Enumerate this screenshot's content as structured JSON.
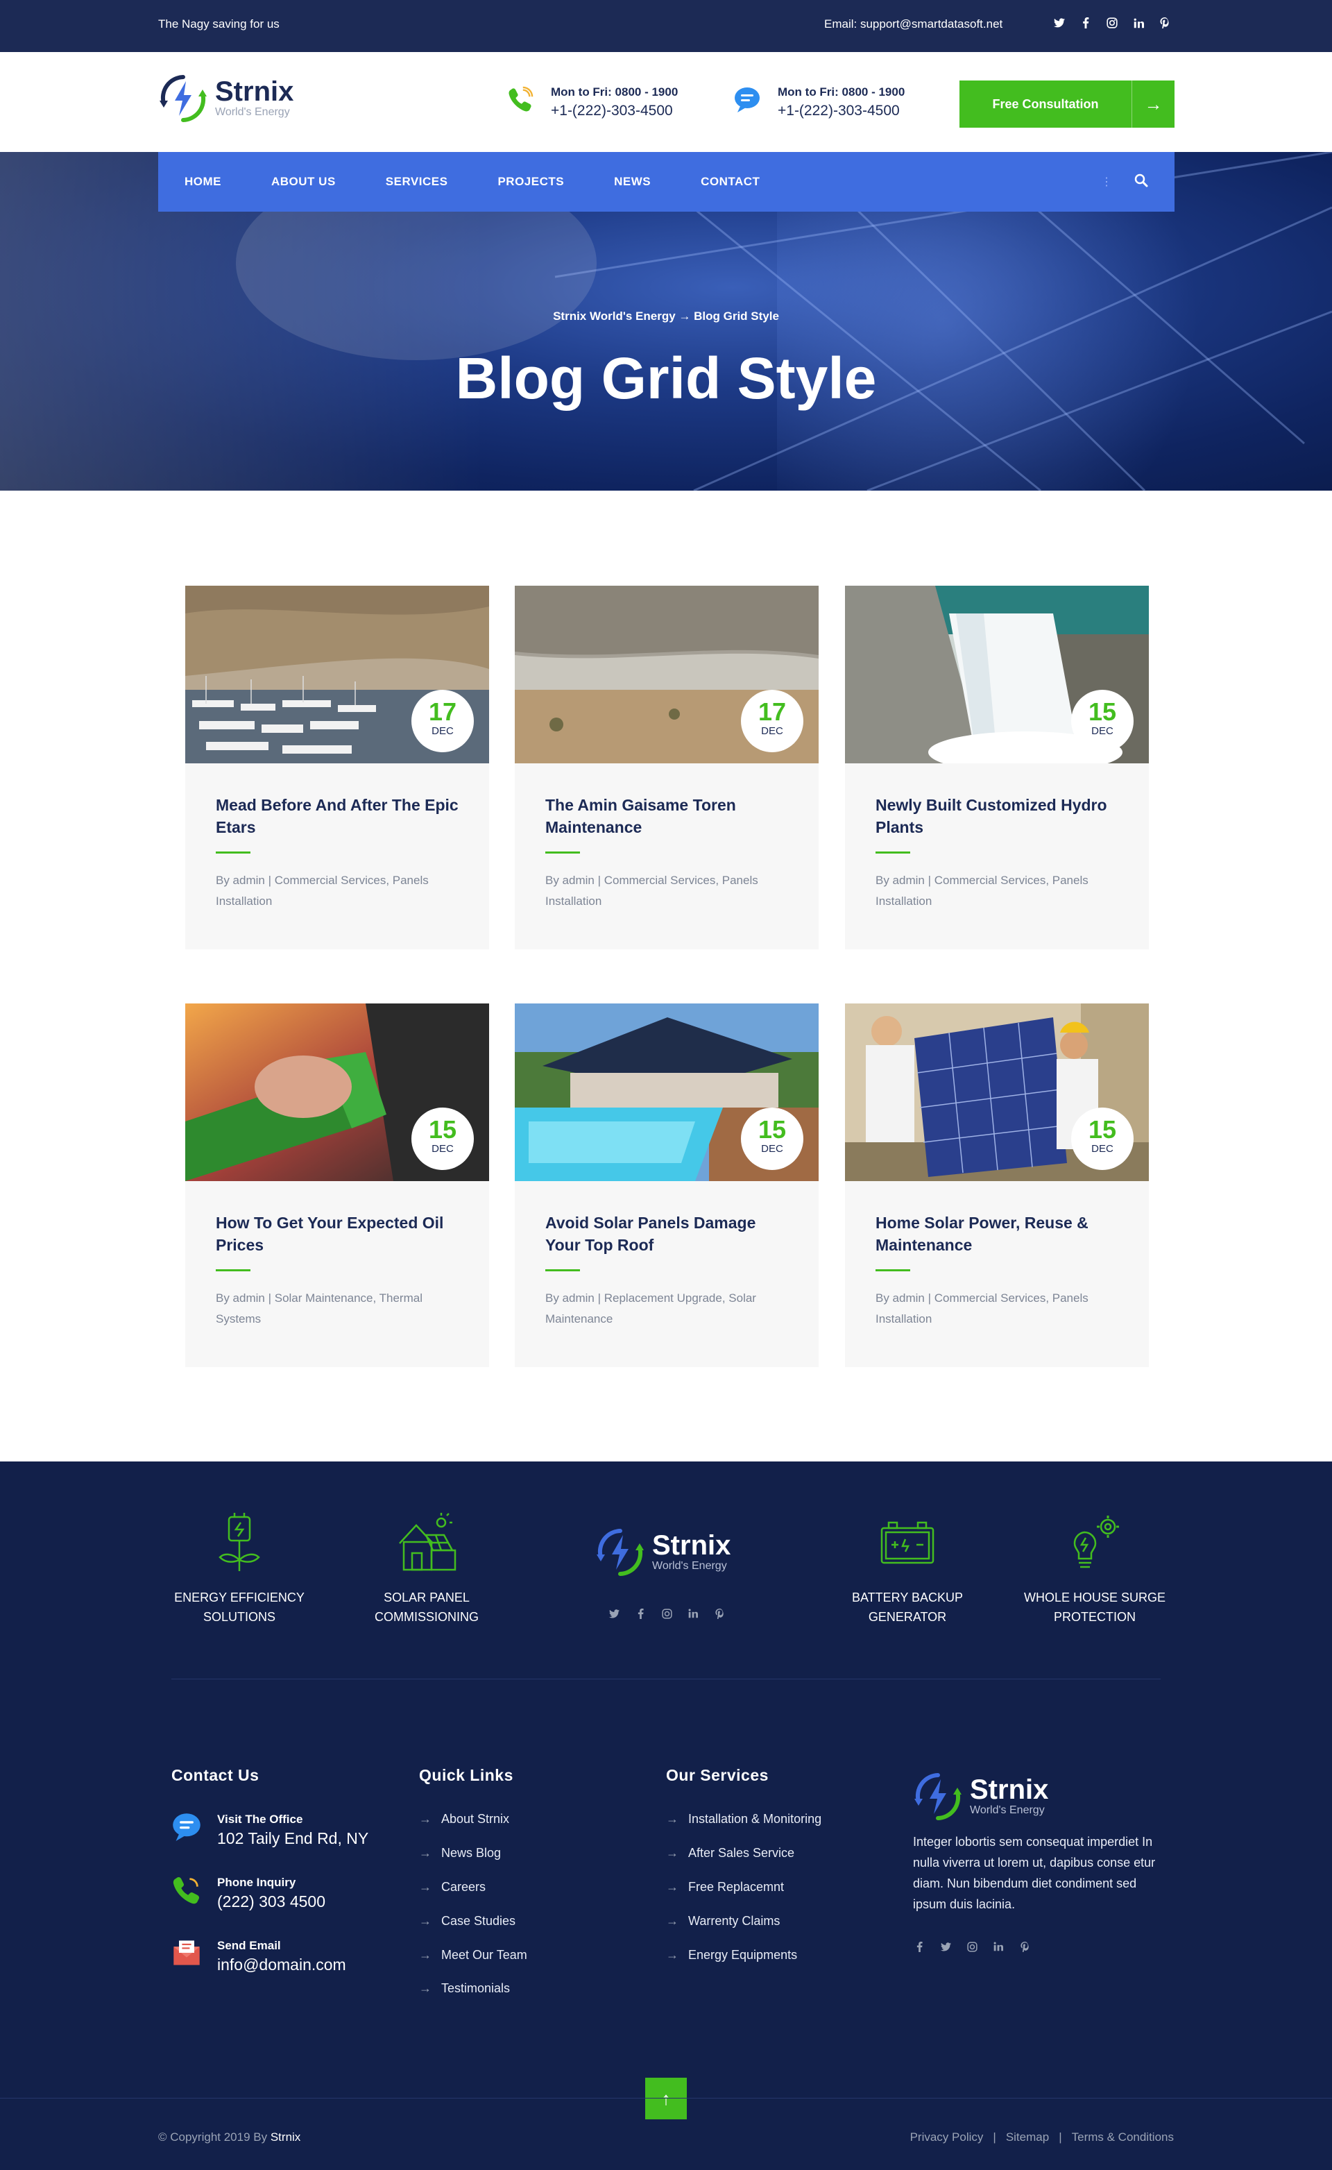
{
  "topbar": {
    "tagline": "The Nagy saving for us",
    "email": "Email: support@smartdatasoft.net",
    "social": [
      "twitter-icon",
      "facebook-icon",
      "instagram-icon",
      "linkedin-icon",
      "pinterest-icon"
    ]
  },
  "header": {
    "logo_name": "Strnix",
    "logo_sub": "World's Energy",
    "contacts": [
      {
        "hours": "Mon to Fri: 0800 - 1900",
        "phone": "+1-(222)-303-4500",
        "icon": "phone-icon"
      },
      {
        "hours": "Mon to Fri: 0800 - 1900",
        "phone": "+1-(222)-303-4500",
        "icon": "chat-icon"
      }
    ],
    "cta_label": "Free Consultation",
    "cta_arrow": "→"
  },
  "nav": {
    "items": [
      "HOME",
      "ABOUT US",
      "SERVICES",
      "PROJECTS",
      "NEWS",
      "CONTACT"
    ],
    "dots": "⋮"
  },
  "hero": {
    "breadcrumb": "Strnix World's Energy → Blog Grid Style",
    "title": "Blog Grid Style"
  },
  "posts": [
    {
      "day": "17",
      "month": "DEC",
      "title": "Mead Before And After The Epic Etars",
      "meta": "By admin | Commercial Services, Panels Installation"
    },
    {
      "day": "17",
      "month": "DEC",
      "title": "The Amin Gaisame Toren Maintenance",
      "meta": "By admin | Commercial Services, Panels Installation"
    },
    {
      "day": "15",
      "month": "DEC",
      "title": "Newly Built Customized Hydro Plants",
      "meta": "By admin | Commercial Services, Panels Installation"
    },
    {
      "day": "15",
      "month": "DEC",
      "title": "How To Get Your Expected Oil Prices",
      "meta": "By admin | Solar Maintenance, Thermal Systems"
    },
    {
      "day": "15",
      "month": "DEC",
      "title": "Avoid Solar Panels Damage Your Top Roof",
      "meta": "By admin | Replacement Upgrade, Solar Maintenance"
    },
    {
      "day": "15",
      "month": "DEC",
      "title": "Home Solar Power, Reuse & Maintenance",
      "meta": "By admin | Commercial Services, Panels Installation"
    }
  ],
  "footer": {
    "features": [
      {
        "line1": "ENERGY EFFICIENCY",
        "line2": "SOLUTIONS",
        "icon": "plug-leaf-icon"
      },
      {
        "line1": "SOLAR PANEL",
        "line2": "COMMISSIONING",
        "icon": "solar-house-icon"
      },
      {
        "line1": "BATTERY BACKUP",
        "line2": "GENERATOR",
        "icon": "battery-icon"
      },
      {
        "line1": "WHOLE HOUSE SURGE",
        "line2": "PROTECTION",
        "icon": "bulb-gear-icon"
      }
    ],
    "logo_name": "Strnix",
    "logo_sub": "World's Energy",
    "contact_heading": "Contact Us",
    "contact": [
      {
        "label": "Visit The Office",
        "value": "102 Taily End Rd, NY",
        "icon": "chat-icon"
      },
      {
        "label": "Phone Inquiry",
        "value": "(222) 303 4500",
        "icon": "phone-icon"
      },
      {
        "label": "Send Email",
        "value": "info@domain.com",
        "icon": "mail-icon"
      }
    ],
    "links_heading": "Quick Links",
    "links": [
      "About Strnix",
      "News Blog",
      "Careers",
      "Case Studies",
      "Meet Our Team",
      "Testimonials"
    ],
    "services_heading": "Our Services",
    "services": [
      "Installation & Monitoring",
      "After Sales Service",
      "Free Replacemnt",
      "Warrenty Claims",
      "Energy Equipments"
    ],
    "about": "Integer lobortis sem consequat imperdiet In nulla viverra ut lorem ut, dapibus conse etur diam. Nun bibendum diet condiment sed ipsum duis lacinia.",
    "arrow": "→",
    "to_top": "↑",
    "copyright_prefix": "© Copyright 2019 By",
    "copyright_brand": "Strnix",
    "legal": [
      "Privacy Policy",
      "|",
      "Sitemap",
      "|",
      "Terms & Conditions"
    ]
  },
  "colors": {
    "navy": "#1c2a55",
    "footer_bg": "#12204a",
    "nav_blue": "#3f6de0",
    "green": "#43bd1f"
  }
}
